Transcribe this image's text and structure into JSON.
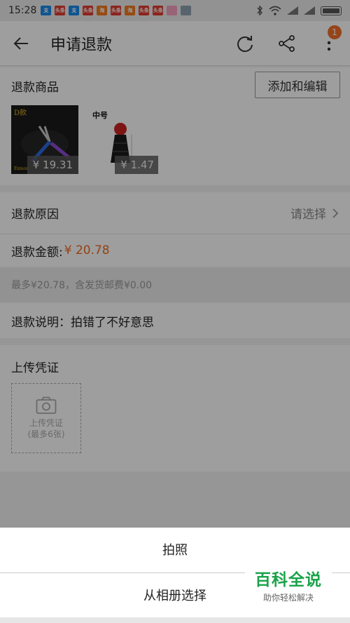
{
  "status_bar": {
    "time": "15:28",
    "notifications": [
      {
        "icon": "alipay-icon",
        "glyph": "支",
        "style": "blue"
      },
      {
        "icon": "toutiao-icon",
        "glyph": "头条",
        "style": "red"
      },
      {
        "icon": "alipay-icon",
        "glyph": "支",
        "style": "blue"
      },
      {
        "icon": "toutiao-icon",
        "glyph": "头条",
        "style": "red"
      },
      {
        "icon": "taobao-icon",
        "glyph": "淘",
        "style": "orange"
      },
      {
        "icon": "toutiao-icon",
        "glyph": "头条",
        "style": "red"
      },
      {
        "icon": "app-icon",
        "glyph": "淘",
        "style": "orange"
      },
      {
        "icon": "toutiao-icon",
        "glyph": "头条",
        "style": "red"
      },
      {
        "icon": "toutiao-icon",
        "glyph": "头条",
        "style": "red"
      },
      {
        "icon": "app-icon",
        "glyph": "",
        "style": "pink"
      },
      {
        "icon": "screenshot-icon",
        "glyph": "",
        "style": "gray"
      }
    ],
    "icons": [
      "bluetooth-icon",
      "wifi-icon",
      "signal-icon",
      "signal-icon",
      "battery-icon"
    ]
  },
  "header": {
    "title": "申请退款",
    "badge_count": "1"
  },
  "goods": {
    "title": "退款商品",
    "edit_button": "添加和编辑",
    "items": [
      {
        "price": "¥ 19.31"
      },
      {
        "label": "中号",
        "price": "¥ 1.47"
      }
    ]
  },
  "reason": {
    "label": "退款原因",
    "placeholder": "请选择"
  },
  "amount": {
    "label": "退款金额:",
    "value": "¥ 20.78"
  },
  "max_note": "最多¥20.78，含发货邮费¥0.00",
  "explain": {
    "text": "退款说明：拍错了不好意思"
  },
  "upload": {
    "title": "上传凭证",
    "box_line1": "上传凭证",
    "box_line2": "(最多6张)"
  },
  "sheet": {
    "photo": "拍照",
    "album": "从相册选择"
  },
  "watermark": {
    "title": "百科全说",
    "subtitle": "助你轻松解决"
  },
  "colors": {
    "accent": "#f26b1d",
    "badge": "#f0702a",
    "watermark_green": "#1aa34a"
  }
}
